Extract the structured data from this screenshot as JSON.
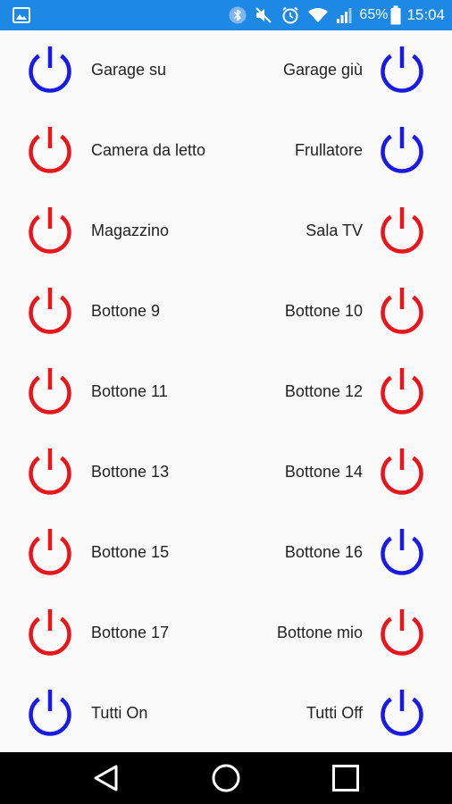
{
  "status_bar": {
    "battery_percent": "65%",
    "time": "15:04",
    "icons": [
      "image-icon",
      "bluetooth-icon",
      "mute-icon",
      "alarm-icon",
      "wifi-icon",
      "signal-icon",
      "battery-icon"
    ],
    "bg_color": "#1e88e5"
  },
  "colors": {
    "off": "#e8151b",
    "on": "#1a1ae6"
  },
  "buttons": [
    {
      "label": "Garage su",
      "state": "on"
    },
    {
      "label": "Garage giù",
      "state": "on"
    },
    {
      "label": "Camera da letto",
      "state": "off"
    },
    {
      "label": "Frullatore",
      "state": "on"
    },
    {
      "label": "Magazzino",
      "state": "off"
    },
    {
      "label": "Sala TV",
      "state": "off"
    },
    {
      "label": "Bottone 9",
      "state": "off"
    },
    {
      "label": "Bottone 10",
      "state": "off"
    },
    {
      "label": "Bottone 11",
      "state": "off"
    },
    {
      "label": "Bottone 12",
      "state": "off"
    },
    {
      "label": "Bottone 13",
      "state": "off"
    },
    {
      "label": "Bottone 14",
      "state": "off"
    },
    {
      "label": "Bottone 15",
      "state": "off"
    },
    {
      "label": "Bottone 16",
      "state": "on"
    },
    {
      "label": "Bottone 17",
      "state": "off"
    },
    {
      "label": "Bottone mio",
      "state": "off"
    },
    {
      "label": "Tutti On",
      "state": "on"
    },
    {
      "label": "Tutti Off",
      "state": "on"
    }
  ],
  "nav_bar": {
    "icons": [
      "back-icon",
      "home-icon",
      "recents-icon"
    ]
  }
}
